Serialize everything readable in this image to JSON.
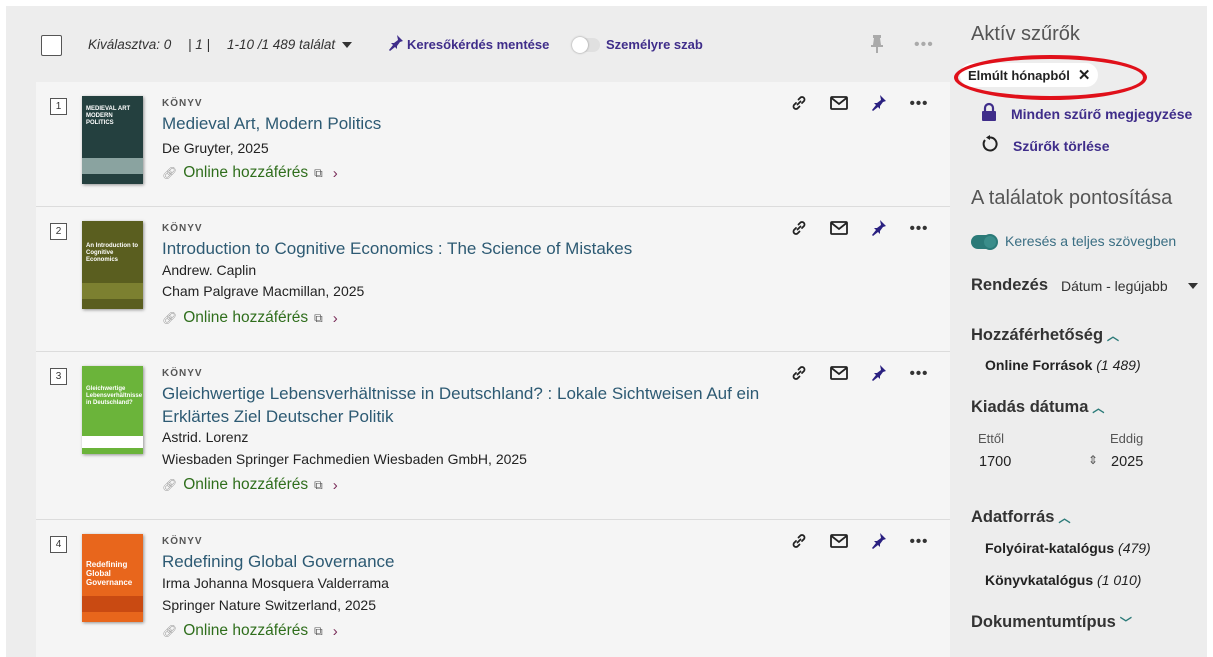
{
  "toolbar": {
    "selected_label": "Kiválasztva: 0",
    "page_label": "| 1 |",
    "range_label": "1-10 /1 489 találat",
    "save_query_label": "Keresőkérdés mentése",
    "personalize_label": "Személyre szab"
  },
  "results": [
    {
      "num": "1",
      "type": "KÖNYV",
      "title": "Medieval Art, Modern Politics",
      "meta": [
        "De Gruyter, 2025"
      ],
      "online": "Online hozzáférés",
      "cover_text": "MEDIEVAL ART MODERN POLITICS",
      "cover_color": "#24403f"
    },
    {
      "num": "2",
      "type": "KÖNYV",
      "title": "Introduction to Cognitive Economics : The Science of Mistakes",
      "meta": [
        "Andrew. Caplin",
        "Cham Palgrave Macmillan, 2025"
      ],
      "online": "Online hozzáférés",
      "cover_text": "An Introduction to Cognitive Economics",
      "cover_color": "#5a5e1f"
    },
    {
      "num": "3",
      "type": "KÖNYV",
      "title": "Gleichwertige Lebensverhältnisse in Deutschland? : Lokale Sichtweisen Auf ein Erklärtes Ziel Deutscher Politik",
      "meta": [
        "Astrid. Lorenz",
        "Wiesbaden Springer Fachmedien Wiesbaden GmbH, 2025"
      ],
      "online": "Online hozzáférés",
      "cover_text": "Gleichwertige Lebensverhältnisse in Deutschland?",
      "cover_color": "#6bb43a"
    },
    {
      "num": "4",
      "type": "KÖNYV",
      "title": "Redefining Global Governance",
      "meta": [
        "Irma Johanna Mosquera Valderrama",
        "Springer Nature Switzerland, 2025"
      ],
      "online": "Online hozzáférés",
      "cover_text": "Redefining Global Governance",
      "cover_color": "#e8661c"
    }
  ],
  "sidebar": {
    "active_filters_title": "Aktív szűrők",
    "active_chip": "Elmúlt hónapból",
    "remember_all": "Minden szűrő megjegyzése",
    "clear_filters": "Szűrők törlése",
    "refine_title": "A találatok pontosítása",
    "fulltext_toggle": "Keresés a teljes szövegben",
    "sort_label": "Rendezés",
    "sort_value": "Dátum - legújabb",
    "availability_title": "Hozzáférhetőség",
    "availability_items": [
      {
        "label": "Online Források",
        "count": "(1 489)"
      }
    ],
    "pubdate_title": "Kiadás dátuma",
    "from_label": "Ettől",
    "to_label": "Eddig",
    "from_value": "1700",
    "to_value": "2025",
    "source_title": "Adatforrás",
    "source_items": [
      {
        "label": "Folyóirat-katalógus",
        "count": "(479)"
      },
      {
        "label": "Könyvkatalógus",
        "count": "(1 010)"
      }
    ],
    "doctype_title": "Dokumentumtípus"
  },
  "colors": {
    "accent_purple": "#3f2d8a",
    "title_link": "#2d5a73",
    "online_green": "#2f6e1c",
    "highlight_ring": "#e0101a",
    "toggle_teal": "#2b7a78"
  }
}
